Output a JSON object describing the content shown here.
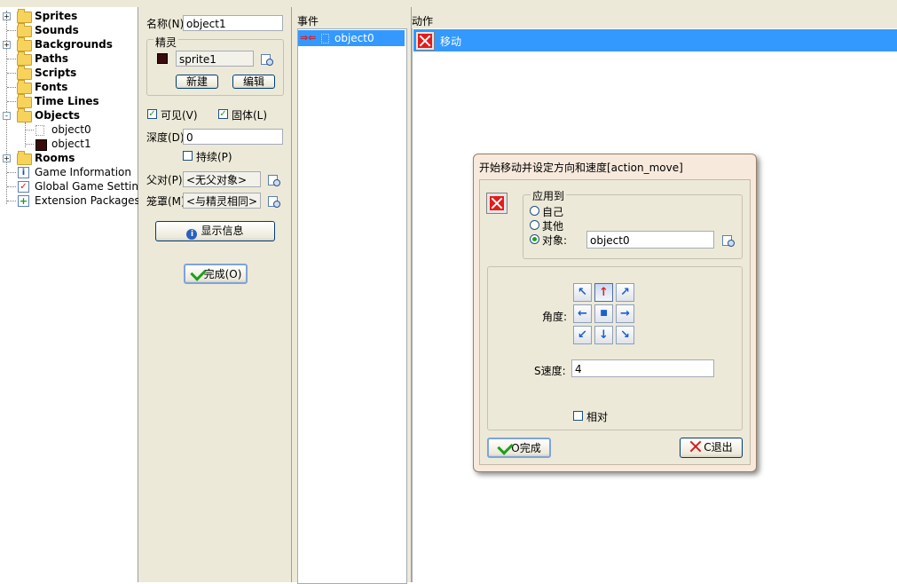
{
  "tree": {
    "items": [
      {
        "label": "Sprites",
        "expander": "+"
      },
      {
        "label": "Sounds",
        "expander": ""
      },
      {
        "label": "Backgrounds",
        "expander": "+"
      },
      {
        "label": "Paths",
        "expander": ""
      },
      {
        "label": "Scripts",
        "expander": ""
      },
      {
        "label": "Fonts",
        "expander": ""
      },
      {
        "label": "Time Lines",
        "expander": ""
      },
      {
        "label": "Objects",
        "expander": "-"
      },
      {
        "label": "object0"
      },
      {
        "label": "object1"
      },
      {
        "label": "Rooms",
        "expander": "+"
      },
      {
        "label": "Game Information"
      },
      {
        "label": "Global Game Settings"
      },
      {
        "label": "Extension Packages"
      }
    ]
  },
  "props": {
    "name_label": "名称(N)",
    "name_value": "object1",
    "sprite_group": "精灵",
    "sprite_value": "sprite1",
    "new_button": "新建",
    "edit_button": "编辑",
    "visible_label": "可见(V)",
    "solid_label": "固体(L)",
    "depth_label": "深度(D)",
    "depth_value": "0",
    "persistent_label": "持续(P)",
    "parent_label": "父对(P)",
    "parent_value": "<无父对象>",
    "mask_label": "笼罩(M)",
    "mask_value": "<与精灵相同>",
    "show_info_button": "显示信息",
    "ok_button": "完成(O)"
  },
  "events": {
    "header": "事件",
    "items": [
      {
        "label": "object0"
      }
    ]
  },
  "actions": {
    "header": "动作",
    "items": [
      {
        "label": "移动"
      }
    ]
  },
  "dialog": {
    "title": "开始移动并设定方向和速度[action_move]",
    "applies_to": "应用到",
    "self": "自己",
    "other": "其他",
    "object": "对象:",
    "object_value": "object0",
    "direction_label": "角度:",
    "speed_label": "S速度:",
    "speed_value": "4",
    "relative_label": "相对",
    "ok_button": "O完成",
    "cancel_button": "C退出",
    "arrows": {
      "nw": "↖",
      "n": "↑",
      "ne": "↗",
      "w": "←",
      "stop": "■",
      "e": "→",
      "sw": "↙",
      "s": "↓",
      "se": "↘"
    }
  },
  "colors": {
    "selection": "#3399ff",
    "panel": "#ece9d8",
    "dialog_frame": "#f7e9dc"
  }
}
